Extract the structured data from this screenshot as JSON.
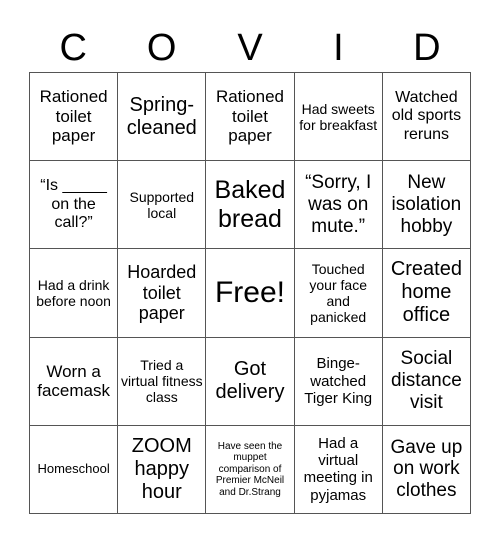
{
  "title_letters": [
    "C",
    "O",
    "V",
    "I",
    "D"
  ],
  "cells": [
    {
      "text": "Rationed toilet paper",
      "size": 17
    },
    {
      "text": "Spring-\ncleaned",
      "size": 20
    },
    {
      "text": "Rationed toilet paper",
      "size": 17
    },
    {
      "text": "Had sweets for breakfast",
      "size": 14
    },
    {
      "text": "Watched old sports reruns",
      "size": 16
    },
    {
      "text": "“Is _____ on the call?”",
      "size": 16
    },
    {
      "text": "Supported local",
      "size": 14
    },
    {
      "text": "Baked bread",
      "size": 25
    },
    {
      "text": "“Sorry, I was on mute.”",
      "size": 19
    },
    {
      "text": "New isolation hobby",
      "size": 19
    },
    {
      "text": "Had a drink before noon",
      "size": 14
    },
    {
      "text": "Hoarded toilet paper",
      "size": 18
    },
    {
      "text": "Free!",
      "size": 30
    },
    {
      "text": "Touched your face and panicked",
      "size": 14
    },
    {
      "text": "Created home office",
      "size": 20
    },
    {
      "text": "Worn a facemask",
      "size": 17
    },
    {
      "text": "Tried a virtual fitness class",
      "size": 14
    },
    {
      "text": "Got delivery",
      "size": 20
    },
    {
      "text": "Binge-\nwatched Tiger King",
      "size": 15
    },
    {
      "text": "Social distance visit",
      "size": 19
    },
    {
      "text": "Homeschool",
      "size": 13
    },
    {
      "text": "ZOOM happy hour",
      "size": 20
    },
    {
      "text": "Have seen the muppet comparison of Premier McNeil and Dr.Strang",
      "size": 10
    },
    {
      "text": "Had a virtual meeting in pyjamas",
      "size": 15
    },
    {
      "text": "Gave up on work clothes",
      "size": 19
    }
  ]
}
